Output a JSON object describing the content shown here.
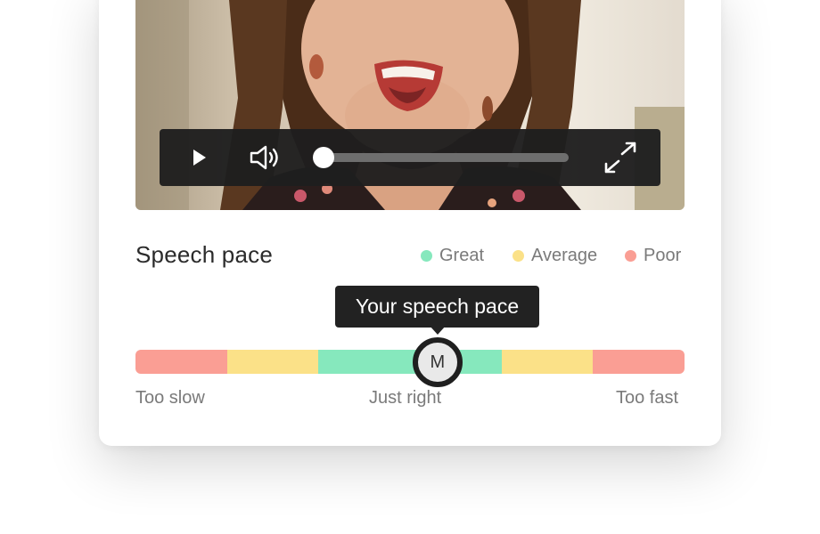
{
  "video": {
    "controls": {
      "play_icon": "play-icon",
      "volume_icon": "volume-icon",
      "fullscreen_icon": "fullscreen-icon",
      "progress": 0.0
    }
  },
  "speech_pace": {
    "title": "Speech pace",
    "legend": [
      {
        "label": "Great",
        "color": "#86e8bd"
      },
      {
        "label": "Average",
        "color": "#fbe188"
      },
      {
        "label": "Poor",
        "color": "#fa9e94"
      }
    ],
    "tooltip": "Your speech pace",
    "marker_label": "M",
    "marker_position": 0.55,
    "segments": [
      "#fa9e94",
      "#fbe188",
      "#86e8bd",
      "#86e8bd",
      "#fbe188",
      "#fa9e94"
    ],
    "scale": {
      "left": "Too slow",
      "middle": "Just right",
      "right": "Too fast"
    }
  }
}
